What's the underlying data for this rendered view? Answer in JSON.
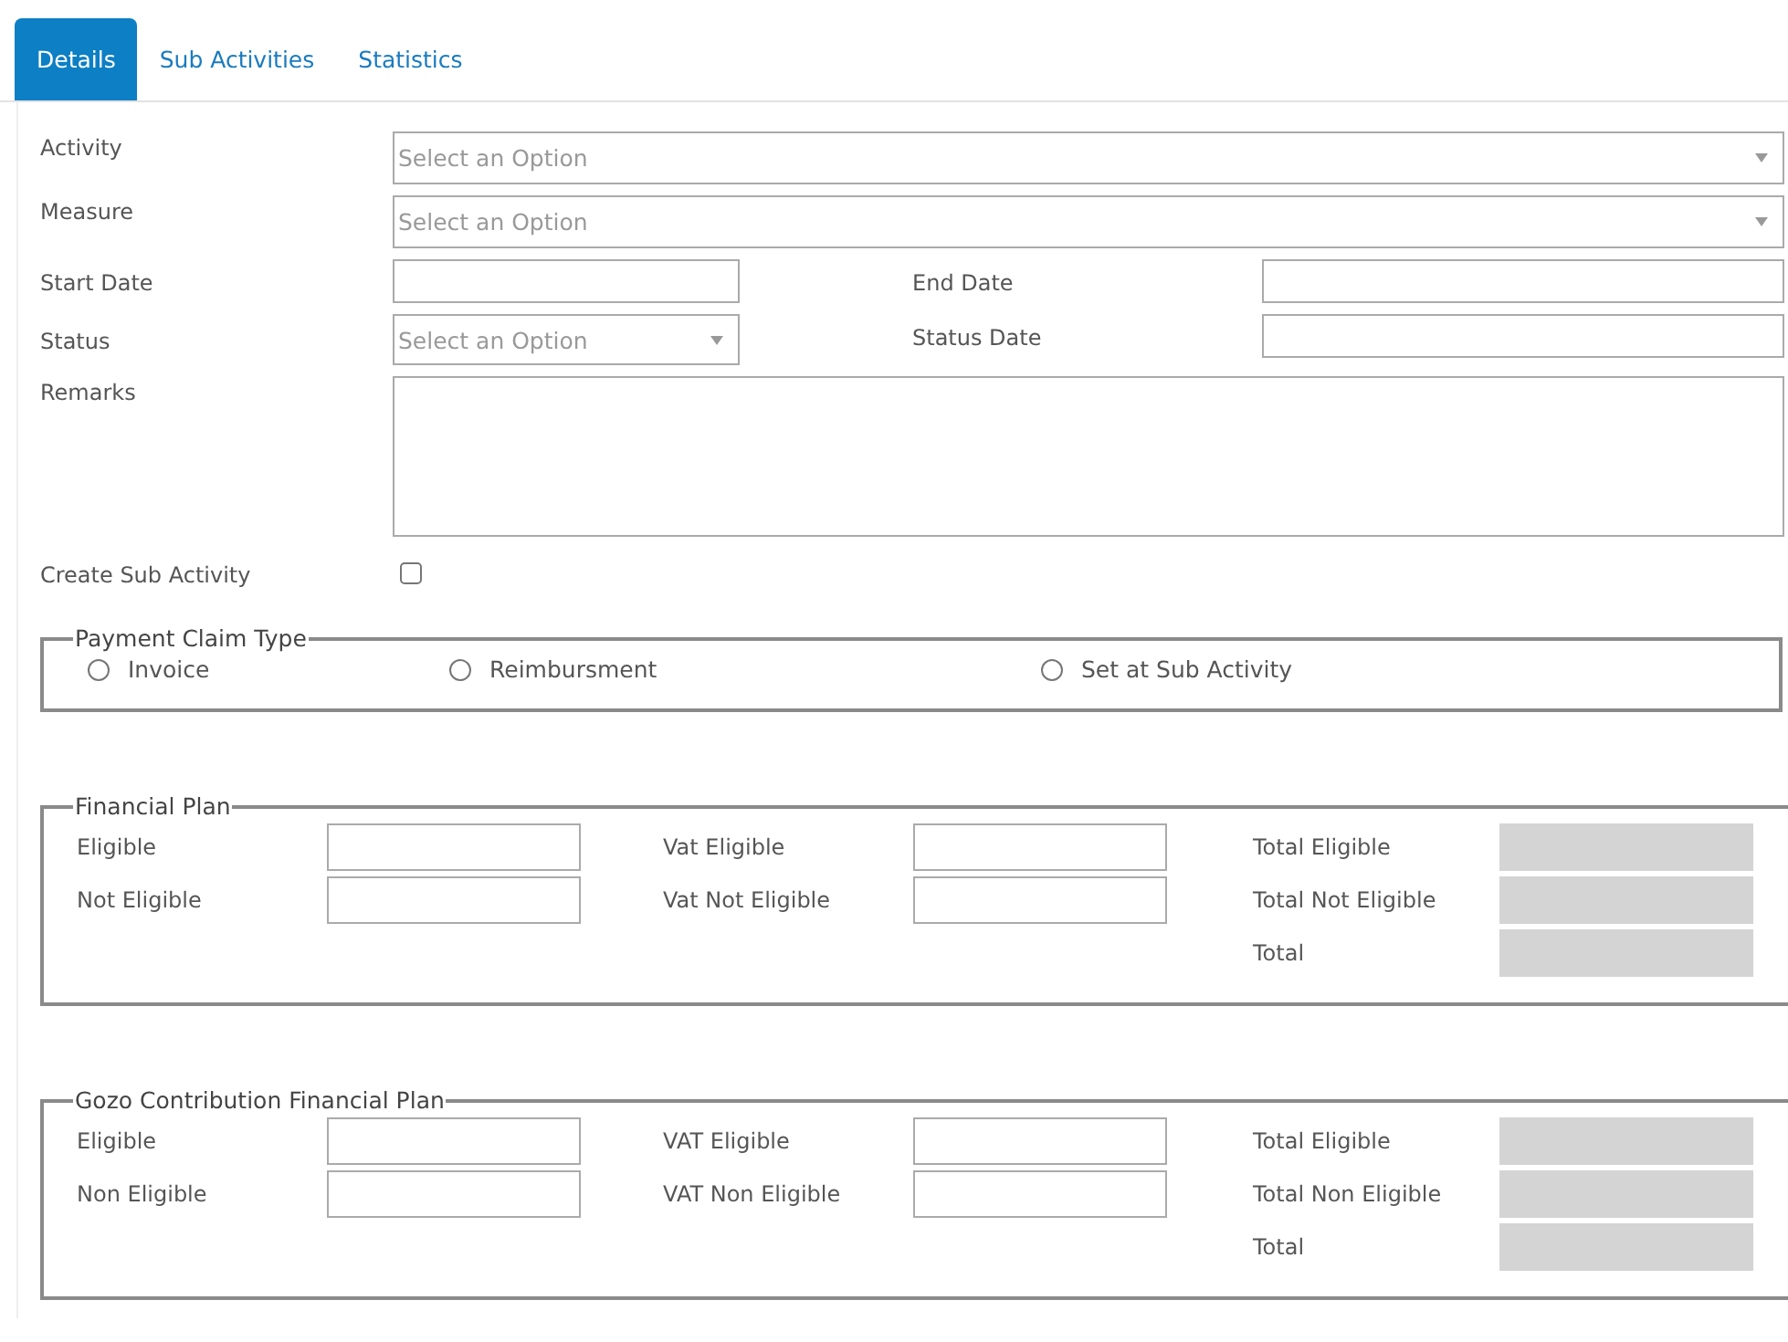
{
  "tabs": [
    {
      "label": "Details",
      "selected": true
    },
    {
      "label": "Sub Activities",
      "selected": false
    },
    {
      "label": "Statistics",
      "selected": false
    }
  ],
  "form_rows": [
    {
      "kind": "select",
      "label": "Activity",
      "placeholder": "Select an Option"
    },
    {
      "kind": "select",
      "label": "Measure",
      "placeholder": "Select an Option"
    },
    {
      "kind": "pair",
      "left": {
        "kind": "text",
        "label": "Start Date"
      },
      "right": {
        "kind": "text",
        "label": "End Date"
      }
    },
    {
      "kind": "pair",
      "left": {
        "kind": "select",
        "label": "Status",
        "placeholder": "Select an Option"
      },
      "right": {
        "kind": "text",
        "label": "Status Date"
      }
    },
    {
      "kind": "textarea",
      "label": "Remarks"
    },
    {
      "kind": "checkbox",
      "label": "Create Sub Activity",
      "checked": false
    }
  ],
  "payment_claim_type": {
    "legend": "Payment Claim Type",
    "options": [
      {
        "label": "Invoice",
        "selected": false
      },
      {
        "label": "Reimbursment",
        "selected": false
      },
      {
        "label": "Set at Sub Activity",
        "selected": false
      }
    ]
  },
  "financial_plans": [
    {
      "legend": "Financial Plan",
      "columns": [
        [
          {
            "label": "Eligible",
            "kind": "input"
          },
          {
            "label": "Not Eligible",
            "kind": "input"
          }
        ],
        [
          {
            "label": "Vat Eligible",
            "kind": "input"
          },
          {
            "label": "Vat Not Eligible",
            "kind": "input"
          }
        ],
        [
          {
            "label": "Total Eligible",
            "kind": "readonly"
          },
          {
            "label": "Total Not Eligible",
            "kind": "readonly"
          },
          {
            "label": "Total",
            "kind": "readonly"
          }
        ]
      ]
    },
    {
      "legend": "Gozo Contribution Financial Plan",
      "columns": [
        [
          {
            "label": "Eligible",
            "kind": "input"
          },
          {
            "label": "Non Eligible",
            "kind": "input"
          }
        ],
        [
          {
            "label": "VAT Eligible",
            "kind": "input"
          },
          {
            "label": "VAT Non Eligible",
            "kind": "input"
          }
        ],
        [
          {
            "label": "Total Eligible",
            "kind": "readonly"
          },
          {
            "label": "Total Non Eligible",
            "kind": "readonly"
          },
          {
            "label": "Total",
            "kind": "readonly"
          }
        ]
      ]
    }
  ]
}
